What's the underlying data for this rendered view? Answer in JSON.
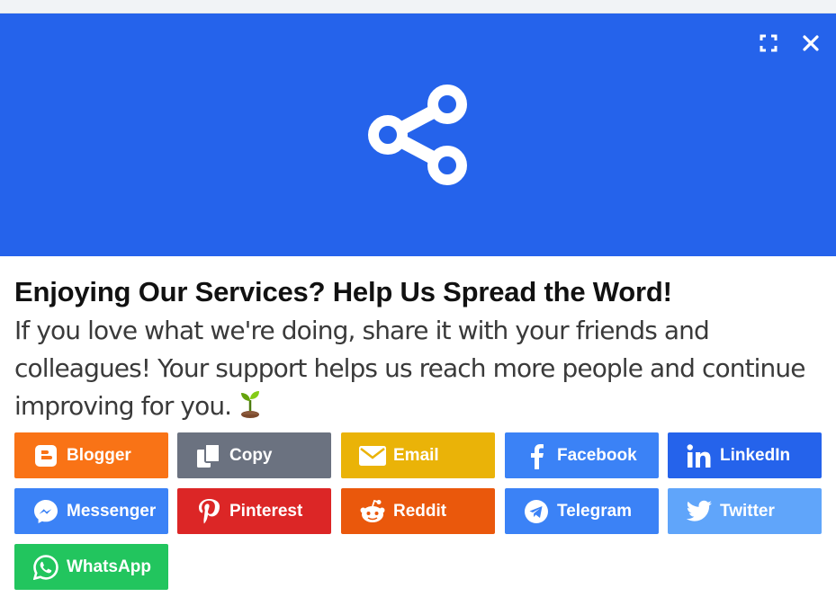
{
  "dialog": {
    "title": "Enjoying Our Services? Help Us Spread the Word!",
    "description": "If you love what we're doing, share it with your friends and colleagues! Your support helps us reach more people and continue improving for you.",
    "hero_icon": "share-icon",
    "hero_color": "#2563eb",
    "controls": {
      "expand_icon": "expand-icon",
      "close_icon": "close-icon"
    }
  },
  "share_buttons": [
    {
      "label": "Blogger",
      "icon": "blogger-icon",
      "color": "#f97316"
    },
    {
      "label": "Copy",
      "icon": "copy-icon",
      "color": "#6b7280"
    },
    {
      "label": "Email",
      "icon": "email-icon",
      "color": "#eab308"
    },
    {
      "label": "Facebook",
      "icon": "facebook-icon",
      "color": "#3b82f6"
    },
    {
      "label": "LinkedIn",
      "icon": "linkedin-icon",
      "color": "#2563eb"
    },
    {
      "label": "Messenger",
      "icon": "messenger-icon",
      "color": "#3b82f6"
    },
    {
      "label": "Pinterest",
      "icon": "pinterest-icon",
      "color": "#dc2626"
    },
    {
      "label": "Reddit",
      "icon": "reddit-icon",
      "color": "#ea580c"
    },
    {
      "label": "Telegram",
      "icon": "telegram-icon",
      "color": "#3b82f6"
    },
    {
      "label": "Twitter",
      "icon": "twitter-icon",
      "color": "#60a5fa"
    },
    {
      "label": "WhatsApp",
      "icon": "whatsapp-icon",
      "color": "#22c55e"
    }
  ]
}
